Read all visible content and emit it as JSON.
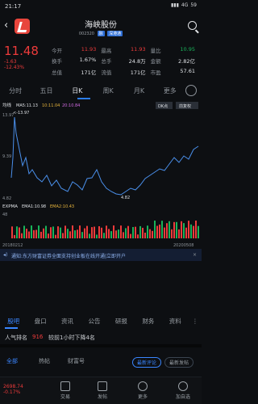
{
  "status": {
    "time": "21:17",
    "battery": "59",
    "network": "4G"
  },
  "header": {
    "title": "海峡股份",
    "code": "002320",
    "badge1": "融",
    "badge2": "深港通"
  },
  "quote": {
    "price": "11.48",
    "change": "-1.63",
    "change_pct": "-12.43%",
    "fields": [
      [
        {
          "label": "今开",
          "value": "11.93",
          "color": "red"
        },
        {
          "label": "最高",
          "value": "11.93",
          "color": "red"
        },
        {
          "label": "量比",
          "value": "10.95",
          "color": "green"
        }
      ],
      [
        {
          "label": "换手",
          "value": "1.67%",
          "color": "white"
        },
        {
          "label": "总手",
          "value": "24.8万",
          "color": "white"
        },
        {
          "label": "金额",
          "value": "2.82亿",
          "color": "white"
        }
      ],
      [
        {
          "label": "总值",
          "value": "171亿",
          "color": "white"
        },
        {
          "label": "流值",
          "value": "171亿",
          "color": "white"
        },
        {
          "label": "市盈",
          "value": "57.61",
          "color": "white"
        }
      ]
    ]
  },
  "tabs": [
    "分时",
    "五日",
    "日K",
    "周K",
    "月K",
    "更多"
  ],
  "active_tab": "日K",
  "chart": {
    "ma_label": "均线",
    "ma5": "MA5:11.13",
    "ma10": "10:11.04",
    "ma20": "20:10.84",
    "top_value": "13.97",
    "top_value2": "<-13.97",
    "mid_value": "9.39",
    "low_value": "4.82",
    "low_marker": "4.82",
    "btn1": "DK点",
    "btn2": "前复权",
    "expma_label": "EXPMA",
    "ema1": "EMA1:10.98",
    "ema2": "EMA2:10.43",
    "vol_top": "48",
    "date_left": "20180212",
    "date_right": "20200508"
  },
  "news": {
    "text": "通知:东方财富证券全面支持创业板在线开通|立即开户",
    "close": "×"
  },
  "footer_tabs": [
    "股吧",
    "盘口",
    "资讯",
    "公告",
    "研报",
    "财务",
    "资料"
  ],
  "rank": {
    "label": "人气排名",
    "value": "916",
    "desc": "较前1小时下降4名"
  },
  "sub_tabs": [
    "全部",
    "热帖",
    "财富号"
  ],
  "pills": [
    "最新评论",
    "最新发帖"
  ],
  "bottom_nav": [
    "交易",
    "发帖",
    "更多",
    "加自选"
  ],
  "mini_quote": {
    "value": "2698.74",
    "pct": "-0.17%"
  }
}
